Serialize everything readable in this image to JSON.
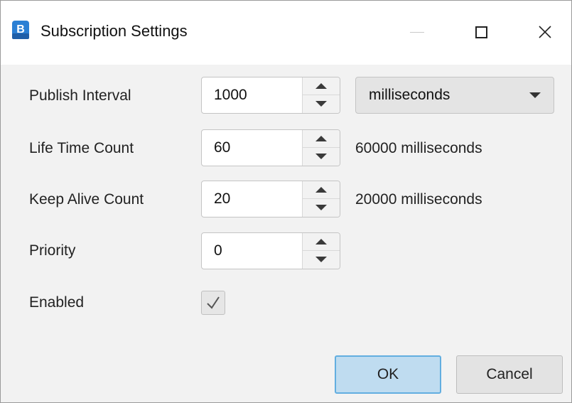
{
  "window": {
    "title": "Subscription Settings",
    "app_icon": "b-app-icon",
    "controls": [
      "minimize-icon",
      "maximize-icon",
      "close-icon"
    ]
  },
  "form": {
    "publish_interval": {
      "label": "Publish Interval",
      "value": "1000",
      "unit_selected": "milliseconds"
    },
    "lifetime_count": {
      "label": "Life Time Count",
      "value": "60",
      "computed": "60000 milliseconds"
    },
    "keep_alive_count": {
      "label": "Keep Alive Count",
      "value": "20",
      "computed": "20000 milliseconds"
    },
    "priority": {
      "label": "Priority",
      "value": "0"
    },
    "enabled": {
      "label": "Enabled",
      "checked": true
    }
  },
  "buttons": {
    "ok": "OK",
    "cancel": "Cancel"
  },
  "colors": {
    "ok_bg": "#bfdcf0",
    "ok_border": "#62aee0",
    "app_icon": "#2a7fd4"
  }
}
